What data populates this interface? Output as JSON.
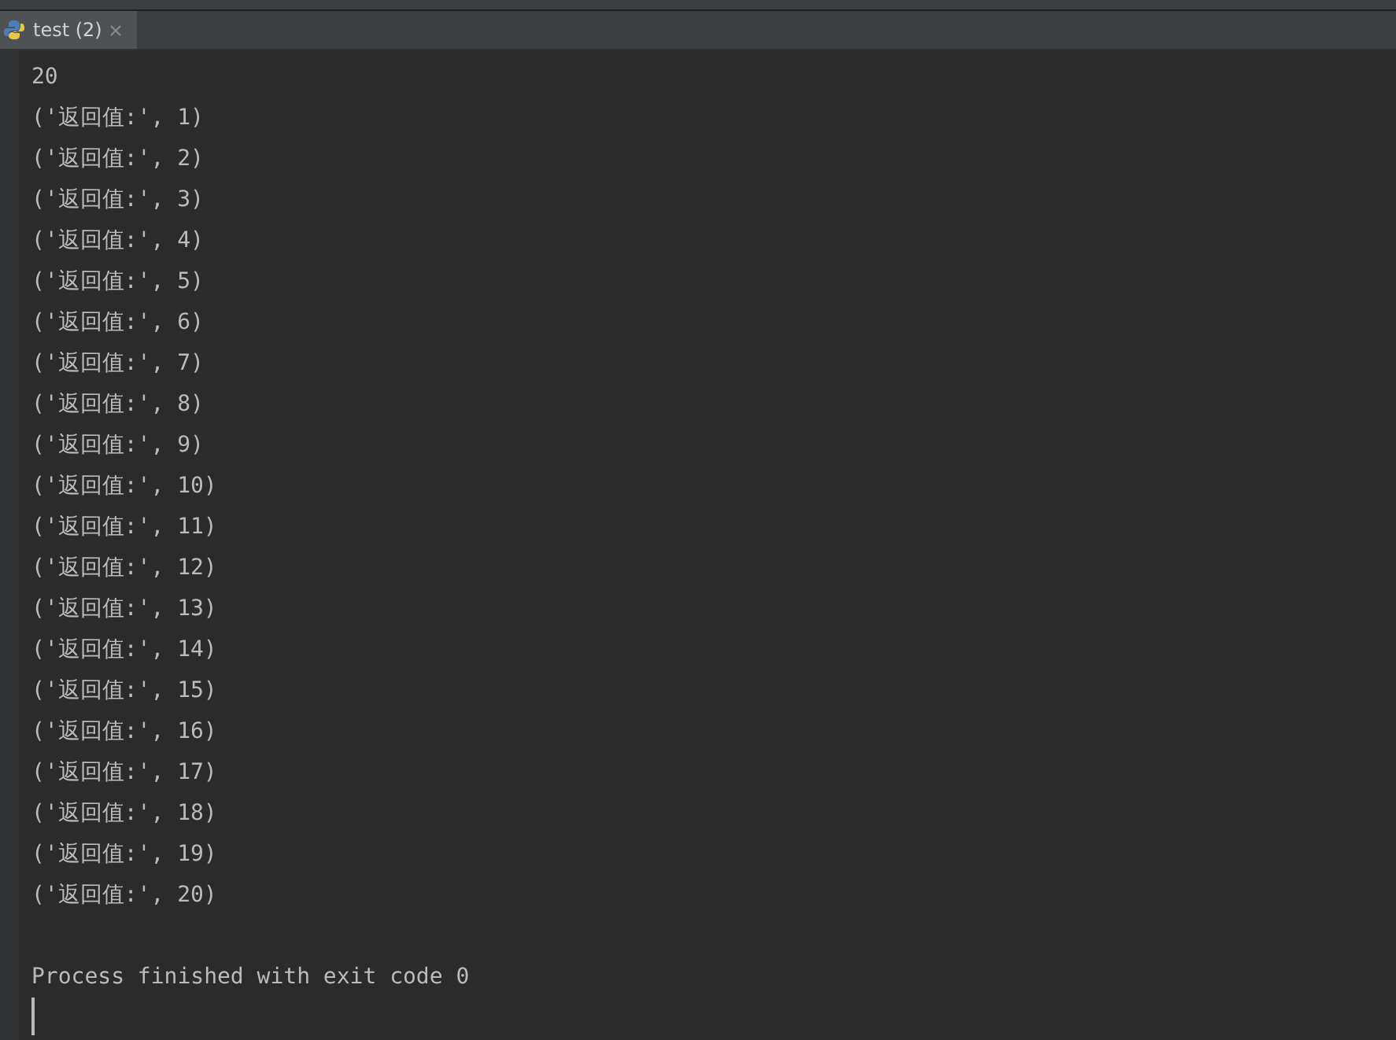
{
  "tabs": [
    {
      "label": "test (2)",
      "selected": true
    }
  ],
  "console": {
    "lines": [
      "20",
      "('返回值:', 1)",
      "('返回值:', 2)",
      "('返回值:', 3)",
      "('返回值:', 4)",
      "('返回值:', 5)",
      "('返回值:', 6)",
      "('返回值:', 7)",
      "('返回值:', 8)",
      "('返回值:', 9)",
      "('返回值:', 10)",
      "('返回值:', 11)",
      "('返回值:', 12)",
      "('返回值:', 13)",
      "('返回值:', 14)",
      "('返回值:', 15)",
      "('返回值:', 16)",
      "('返回值:', 17)",
      "('返回值:', 18)",
      "('返回值:', 19)",
      "('返回值:', 20)"
    ],
    "exit_message": "Process finished with exit code 0",
    "cursor": true
  }
}
